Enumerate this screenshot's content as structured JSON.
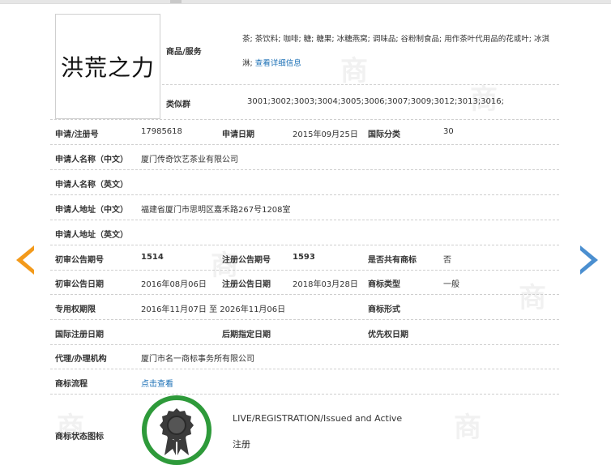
{
  "logo_text": "洪荒之力",
  "watermark_char": "商",
  "goods": {
    "label": "商品/服务",
    "line1": "茶; 茶饮料; 咖啡; 糖; 糖果; 冰糖燕窝; 调味品; 谷粉制食品; 用作茶叶代用品的花或叶; 冰淇",
    "line2_prefix": "淋;",
    "detail_link": "查看详细信息"
  },
  "similar_group": {
    "label": "类似群",
    "value": "3001;3002;3003;3004;3005;3006;3007;3009;3012;3013;3016;"
  },
  "row_reg": {
    "label1": "申请/注册号",
    "value1": "17985618",
    "label2": "申请日期",
    "value2": "2015年09月25日",
    "label3": "国际分类",
    "value3": "30"
  },
  "applicant_cn": {
    "label": "申请人名称（中文）",
    "value": "厦门传奇饮艺茶业有限公司"
  },
  "applicant_en": {
    "label": "申请人名称（英文）",
    "value": ""
  },
  "address_cn": {
    "label": "申请人地址（中文）",
    "value": "福建省厦门市思明区嘉禾路267号1208室"
  },
  "address_en": {
    "label": "申请人地址（英文）",
    "value": ""
  },
  "row_announce_no": {
    "label1": "初审公告期号",
    "value1": "1514",
    "label2": "注册公告期号",
    "value2": "1593",
    "label3": "是否共有商标",
    "value3": "否"
  },
  "row_announce_date": {
    "label1": "初审公告日期",
    "value1": "2016年08月06日",
    "label2": "注册公告日期",
    "value2": "2018年03月28日",
    "label3": "商标类型",
    "value3": "一般"
  },
  "row_exclusive": {
    "label1": "专用权期限",
    "value1": "2016年11月07日 至 2026年11月06日",
    "label3": "商标形式",
    "value3": ""
  },
  "row_intl": {
    "label1": "国际注册日期",
    "label2": "后期指定日期",
    "label3": "优先权日期"
  },
  "agent": {
    "label": "代理/办理机构",
    "value": "厦门市名一商标事务所有限公司"
  },
  "process": {
    "label": "商标流程",
    "link": "点击查看"
  },
  "status": {
    "label": "商标状态图标",
    "line1": "LIVE/REGISTRATION/Issued and Active",
    "line2": "注册"
  },
  "colors": {
    "link": "#1a6fb5",
    "arrow_left": "#f39a1b",
    "arrow_right": "#4b8fd0",
    "badge_ring": "#2e9a3a"
  }
}
